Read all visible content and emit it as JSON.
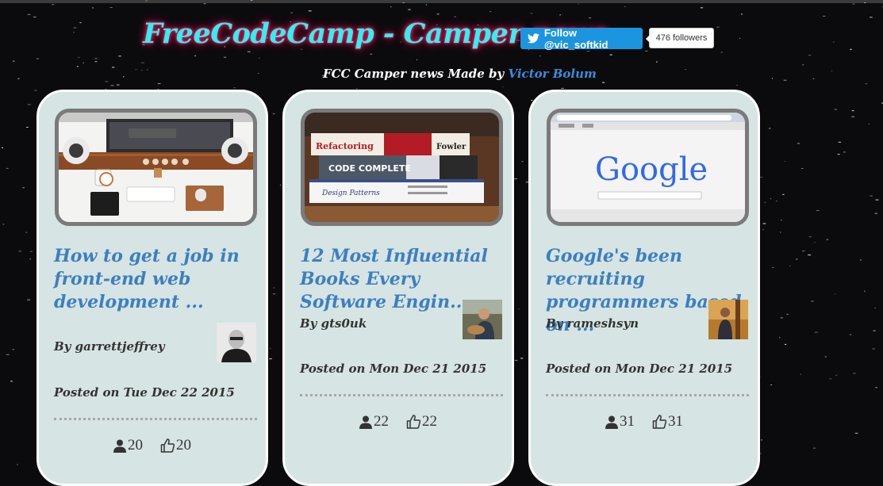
{
  "header": {
    "title": "FreeCodeCamp - Camper news",
    "follow_label": "Follow @vic_softkid",
    "followers_label": "476 followers",
    "subtitle_prefix": "FCC Camper news Made by",
    "author_link": "Victor Bolum"
  },
  "colors": {
    "title": "#2af3f3",
    "title_glow": "#ff1a5e",
    "card_bg": "#d6e4e3",
    "headline": "#3d7fc0",
    "twitter_blue": "#1b95e0"
  },
  "cards": [
    {
      "headline": "How to get a job in front-end web development ...",
      "byline": "By garrettjeffrey",
      "posted": "Posted on Tue Dec 22 2015",
      "upvotes": "20",
      "likes": "20",
      "image": "desk-workspace-photo"
    },
    {
      "headline": "12 Most Influential Books Every Software Engin...",
      "byline": "By gts0uk",
      "posted": "Posted on Mon Dec 21 2015",
      "upvotes": "22",
      "likes": "22",
      "image": "books-stack-photo",
      "book_titles": [
        "Refactoring",
        "Fowler",
        "CODE COMPLETE",
        "Design Patterns"
      ]
    },
    {
      "headline": "Google's been recruiting programmers based on ...",
      "byline": "By rameshsyn",
      "posted": "Posted on Mon Dec 21 2015",
      "upvotes": "31",
      "likes": "31",
      "image": "google-browser-photo",
      "logo_text": "Google"
    }
  ],
  "icons": {
    "user": "user-icon",
    "like": "thumbs-up-icon",
    "twitter": "twitter-bird-icon"
  }
}
